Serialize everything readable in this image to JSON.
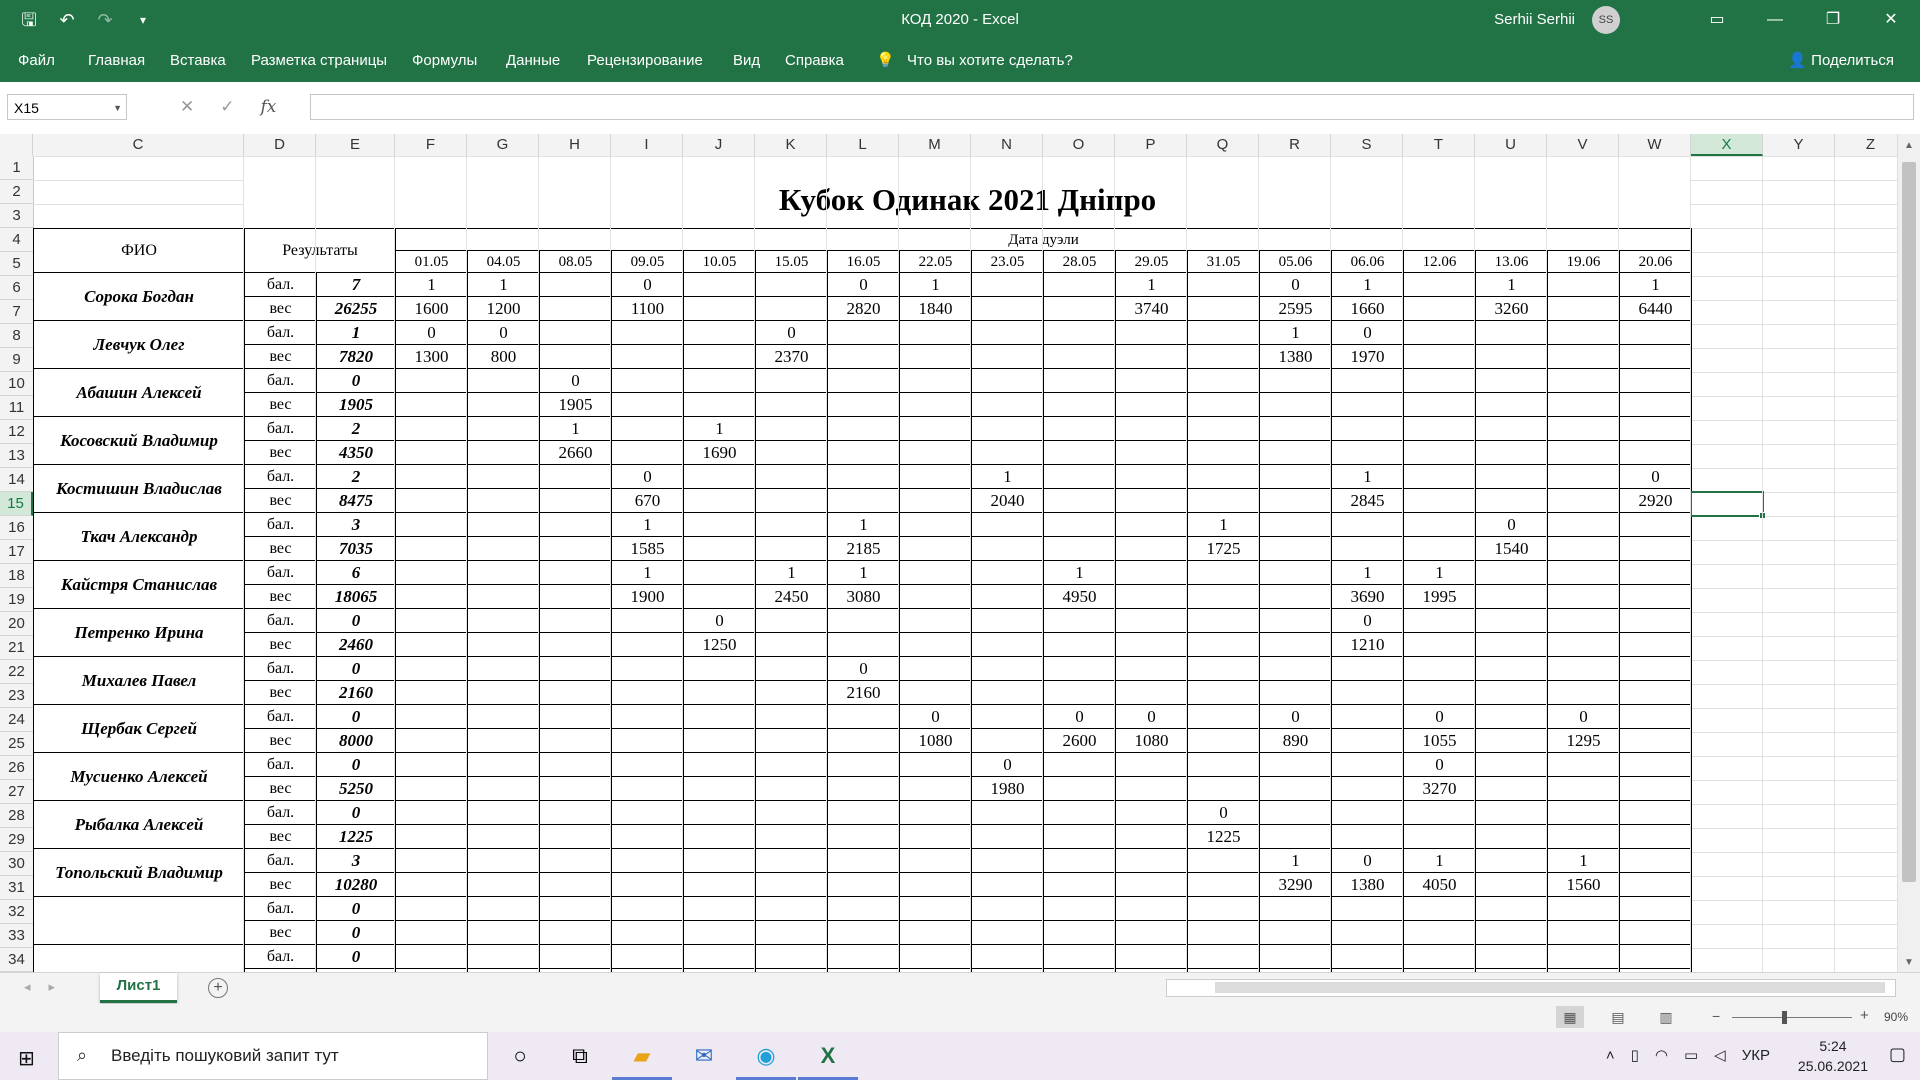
{
  "window": {
    "title": "КОД 2020  -  Excel",
    "user": "Serhii Serhii",
    "user_initials": "SS"
  },
  "ribbon": {
    "tabs": [
      "Файл",
      "Главная",
      "Вставка",
      "Разметка страницы",
      "Формулы",
      "Данные",
      "Рецензирование",
      "Вид",
      "Справка",
      "Что вы хотите сделать?"
    ],
    "share": "Поделиться"
  },
  "formula_bar": {
    "name_box": "X15",
    "fx": "fx",
    "value": ""
  },
  "columns": [
    "C",
    "D",
    "E",
    "F",
    "G",
    "H",
    "I",
    "J",
    "K",
    "L",
    "M",
    "N",
    "O",
    "P",
    "Q",
    "R",
    "S",
    "T",
    "U",
    "V",
    "W",
    "X",
    "Y",
    "Z"
  ],
  "selected_column": "X",
  "rows": [
    "1",
    "2",
    "3",
    "4",
    "5",
    "6",
    "7",
    "8",
    "9",
    "10",
    "11",
    "12",
    "13",
    "14",
    "15",
    "16",
    "17",
    "18",
    "19",
    "20",
    "21",
    "22",
    "23",
    "24",
    "25",
    "26",
    "27",
    "28",
    "29",
    "30",
    "31",
    "32",
    "33",
    "34"
  ],
  "selected_row": "15",
  "sheet_title": "Кубок Одинак 2021 Дніпро",
  "table": {
    "fio_header": "ФИО",
    "results_header": "Результаты",
    "dates_header": "Дата дуэли",
    "dates": [
      "01.05",
      "04.05",
      "08.05",
      "09.05",
      "10.05",
      "15.05",
      "16.05",
      "22.05",
      "23.05",
      "28.05",
      "29.05",
      "31.05",
      "05.06",
      "06.06",
      "12.06",
      "13.06",
      "19.06",
      "20.06"
    ],
    "label_points": "бал.",
    "label_weight": "вес",
    "players": [
      {
        "name": "Сорока Богдан",
        "points_total": "7",
        "weight_total": "26255",
        "points": [
          "1",
          "1",
          "",
          "0",
          "",
          "",
          "0",
          "1",
          "",
          "",
          "1",
          "",
          "0",
          "1",
          "",
          "1",
          "",
          "1"
        ],
        "weights": [
          "1600",
          "1200",
          "",
          "1100",
          "",
          "",
          "2820",
          "1840",
          "",
          "",
          "3740",
          "",
          "2595",
          "1660",
          "",
          "3260",
          "",
          "6440"
        ]
      },
      {
        "name": "Левчук Олег",
        "points_total": "1",
        "weight_total": "7820",
        "points": [
          "0",
          "0",
          "",
          "",
          "",
          "0",
          "",
          "",
          "",
          "",
          "",
          "",
          "1",
          "0",
          "",
          "",
          "",
          ""
        ],
        "weights": [
          "1300",
          "800",
          "",
          "",
          "",
          "2370",
          "",
          "",
          "",
          "",
          "",
          "",
          "1380",
          "1970",
          "",
          "",
          "",
          ""
        ]
      },
      {
        "name": "Абашин Алексей",
        "points_total": "0",
        "weight_total": "1905",
        "points": [
          "",
          "",
          "0",
          "",
          "",
          "",
          "",
          "",
          "",
          "",
          "",
          "",
          "",
          "",
          "",
          "",
          "",
          ""
        ],
        "weights": [
          "",
          "",
          "1905",
          "",
          "",
          "",
          "",
          "",
          "",
          "",
          "",
          "",
          "",
          "",
          "",
          "",
          "",
          ""
        ]
      },
      {
        "name": "Косовский Владимир",
        "points_total": "2",
        "weight_total": "4350",
        "points": [
          "",
          "",
          "1",
          "",
          "1",
          "",
          "",
          "",
          "",
          "",
          "",
          "",
          "",
          "",
          "",
          "",
          "",
          ""
        ],
        "weights": [
          "",
          "",
          "2660",
          "",
          "1690",
          "",
          "",
          "",
          "",
          "",
          "",
          "",
          "",
          "",
          "",
          "",
          "",
          ""
        ]
      },
      {
        "name": "Костишин Владислав",
        "points_total": "2",
        "weight_total": "8475",
        "points": [
          "",
          "",
          "",
          "0",
          "",
          "",
          "",
          "",
          "1",
          "",
          "",
          "",
          "",
          "1",
          "",
          "",
          "",
          "0"
        ],
        "weights": [
          "",
          "",
          "",
          "670",
          "",
          "",
          "",
          "",
          "2040",
          "",
          "",
          "",
          "",
          "2845",
          "",
          "",
          "",
          "2920"
        ]
      },
      {
        "name": "Ткач Александр",
        "points_total": "3",
        "weight_total": "7035",
        "points": [
          "",
          "",
          "",
          "1",
          "",
          "",
          "1",
          "",
          "",
          "",
          "",
          "1",
          "",
          "",
          "",
          "0",
          "",
          ""
        ],
        "weights": [
          "",
          "",
          "",
          "1585",
          "",
          "",
          "2185",
          "",
          "",
          "",
          "",
          "1725",
          "",
          "",
          "",
          "1540",
          "",
          ""
        ]
      },
      {
        "name": "Кайстря Станислав",
        "points_total": "6",
        "weight_total": "18065",
        "points": [
          "",
          "",
          "",
          "1",
          "",
          "1",
          "1",
          "",
          "",
          "1",
          "",
          "",
          "",
          "1",
          "1",
          "",
          "",
          ""
        ],
        "weights": [
          "",
          "",
          "",
          "1900",
          "",
          "2450",
          "3080",
          "",
          "",
          "4950",
          "",
          "",
          "",
          "3690",
          "1995",
          "",
          "",
          ""
        ]
      },
      {
        "name": "Петренко Ирина",
        "points_total": "0",
        "weight_total": "2460",
        "points": [
          "",
          "",
          "",
          "",
          "0",
          "",
          "",
          "",
          "",
          "",
          "",
          "",
          "",
          "0",
          "",
          "",
          "",
          ""
        ],
        "weights": [
          "",
          "",
          "",
          "",
          "1250",
          "",
          "",
          "",
          "",
          "",
          "",
          "",
          "",
          "1210",
          "",
          "",
          "",
          ""
        ]
      },
      {
        "name": "Михалев Павел",
        "points_total": "0",
        "weight_total": "2160",
        "points": [
          "",
          "",
          "",
          "",
          "",
          "",
          "0",
          "",
          "",
          "",
          "",
          "",
          "",
          "",
          "",
          "",
          "",
          ""
        ],
        "weights": [
          "",
          "",
          "",
          "",
          "",
          "",
          "2160",
          "",
          "",
          "",
          "",
          "",
          "",
          "",
          "",
          "",
          "",
          ""
        ]
      },
      {
        "name": "Щербак Сергей",
        "points_total": "0",
        "weight_total": "8000",
        "points": [
          "",
          "",
          "",
          "",
          "",
          "",
          "",
          "0",
          "",
          "0",
          "0",
          "",
          "0",
          "",
          "0",
          "",
          "0",
          ""
        ],
        "weights": [
          "",
          "",
          "",
          "",
          "",
          "",
          "",
          "1080",
          "",
          "2600",
          "1080",
          "",
          "890",
          "",
          "1055",
          "",
          "1295",
          ""
        ]
      },
      {
        "name": "Мусиенко Алексей",
        "points_total": "0",
        "weight_total": "5250",
        "points": [
          "",
          "",
          "",
          "",
          "",
          "",
          "",
          "",
          "0",
          "",
          "",
          "",
          "",
          "",
          "0",
          "",
          "",
          ""
        ],
        "weights": [
          "",
          "",
          "",
          "",
          "",
          "",
          "",
          "",
          "1980",
          "",
          "",
          "",
          "",
          "",
          "3270",
          "",
          "",
          ""
        ]
      },
      {
        "name": "Рыбалка Алексей",
        "points_total": "0",
        "weight_total": "1225",
        "points": [
          "",
          "",
          "",
          "",
          "",
          "",
          "",
          "",
          "",
          "",
          "",
          "0",
          "",
          "",
          "",
          "",
          "",
          ""
        ],
        "weights": [
          "",
          "",
          "",
          "",
          "",
          "",
          "",
          "",
          "",
          "",
          "",
          "1225",
          "",
          "",
          "",
          "",
          "",
          ""
        ]
      },
      {
        "name": "Топольский Владимир",
        "points_total": "3",
        "weight_total": "10280",
        "points": [
          "",
          "",
          "",
          "",
          "",
          "",
          "",
          "",
          "",
          "",
          "",
          "",
          "1",
          "0",
          "1",
          "",
          "1",
          ""
        ],
        "weights": [
          "",
          "",
          "",
          "",
          "",
          "",
          "",
          "",
          "",
          "",
          "",
          "",
          "3290",
          "1380",
          "4050",
          "",
          "1560",
          ""
        ]
      },
      {
        "name": "",
        "points_total": "0",
        "weight_total": "0",
        "points": [
          "",
          "",
          "",
          "",
          "",
          "",
          "",
          "",
          "",
          "",
          "",
          "",
          "",
          "",
          "",
          "",
          "",
          ""
        ],
        "weights": [
          "",
          "",
          "",
          "",
          "",
          "",
          "",
          "",
          "",
          "",
          "",
          "",
          "",
          "",
          "",
          "",
          "",
          ""
        ]
      },
      {
        "name": "",
        "points_total": "0",
        "weight_total": "",
        "points": [
          "",
          "",
          "",
          "",
          "",
          "",
          "",
          "",
          "",
          "",
          "",
          "",
          "",
          "",
          "",
          "",
          "",
          ""
        ],
        "weights": [
          "",
          "",
          "",
          "",
          "",
          "",
          "",
          "",
          "",
          "",
          "",
          "",
          "",
          "",
          "",
          "",
          "",
          ""
        ]
      }
    ]
  },
  "sheet_tab": "Лист1",
  "status": {
    "zoom": "90%"
  },
  "taskbar": {
    "search_placeholder": "Введіть пошуковий запит тут",
    "lang": "УКР",
    "time": "5:24",
    "date": "25.06.2021"
  }
}
